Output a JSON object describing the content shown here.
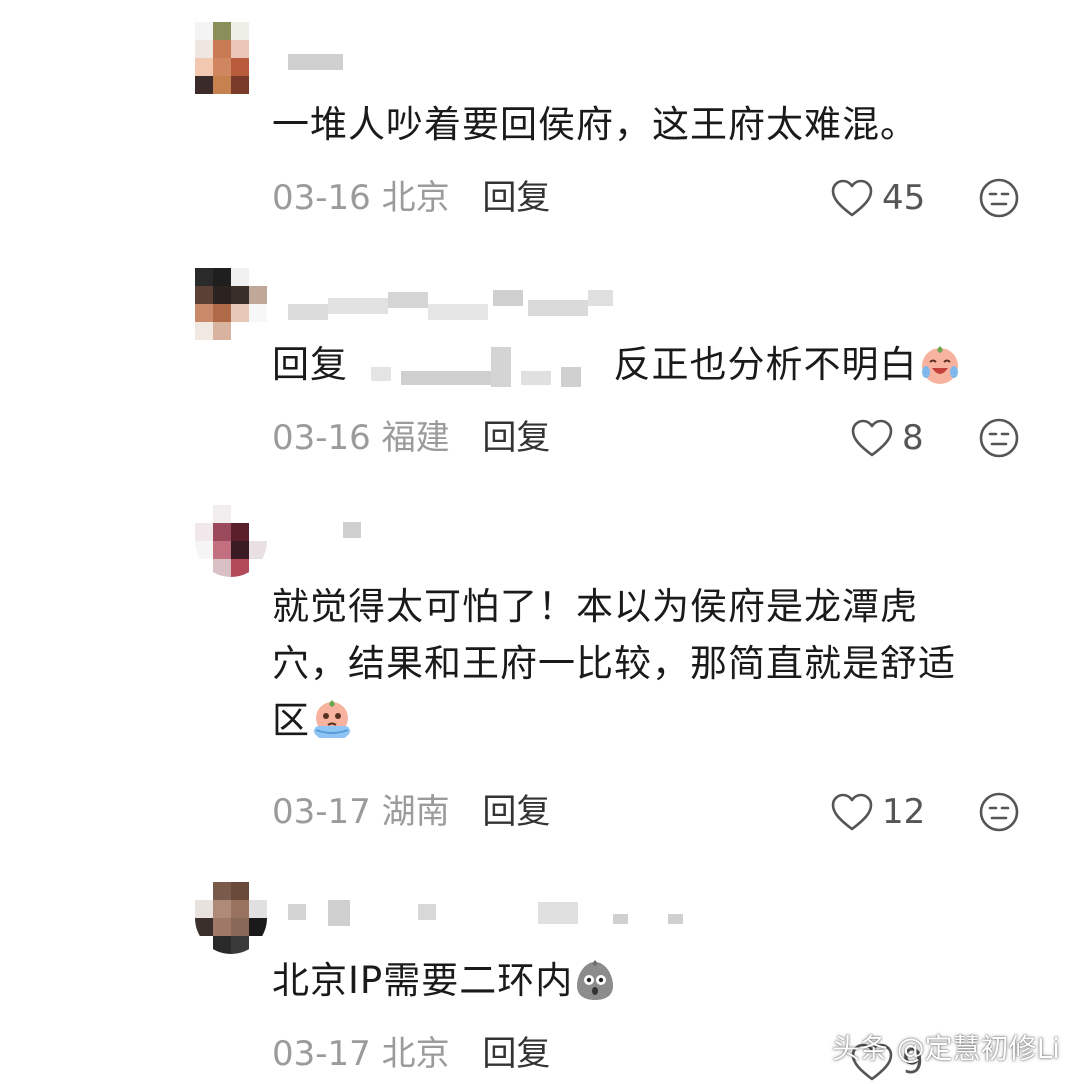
{
  "comments": [
    {
      "username": "",
      "text": "一堆人吵着要回侯府，这王府太难混。",
      "date": "03-16",
      "location": "北京",
      "reply_label": "回复",
      "likes": "45"
    },
    {
      "username": "",
      "reply_prefix": "回复",
      "text": "反正也分析不明白",
      "emoji": "laughing-crying-peach-emoji",
      "date": "03-16",
      "location": "福建",
      "reply_label": "回复",
      "likes": "8"
    },
    {
      "username": "",
      "text_line1": "就觉得太可怕了！本以为侯府是龙潭虎",
      "text_line2": "穴，结果和王府一比较，那简直就是舒适",
      "text_line3": "区",
      "emoji": "crying-peach-emoji",
      "date": "03-17",
      "location": "湖南",
      "reply_label": "回复",
      "likes": "12"
    },
    {
      "username": "",
      "text": "北京IP需要二环内",
      "emoji": "shocked-gray-emoji",
      "date": "03-17",
      "location": "北京",
      "reply_label": "回复",
      "likes": "9"
    }
  ],
  "watermark": "头条 @定慧初修Li",
  "colors": {
    "meta_gray": "#9b9b9b",
    "text_dark": "#1a1a1a",
    "icon_gray": "#555555"
  },
  "icons": [
    "heart-icon",
    "dislike-face-icon"
  ]
}
